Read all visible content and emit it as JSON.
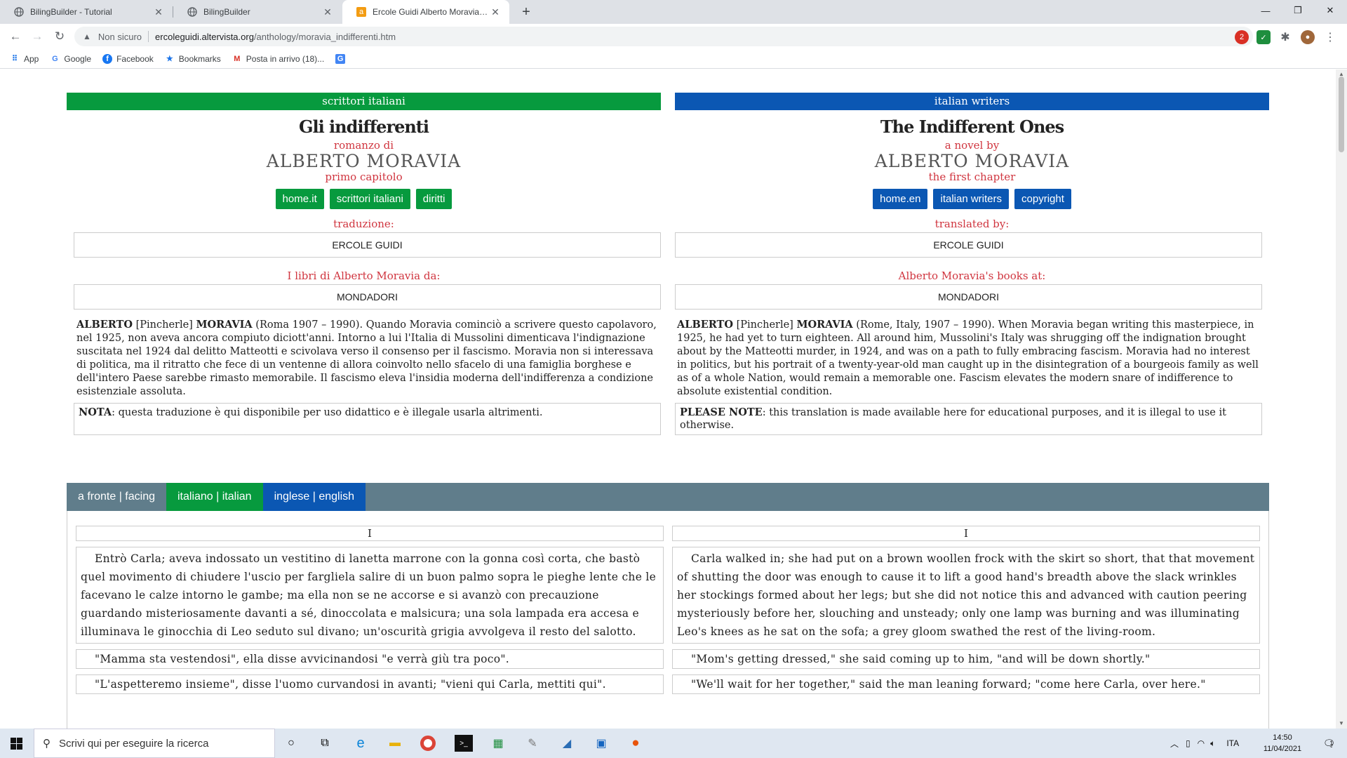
{
  "browser": {
    "tabs": [
      {
        "title": "BilingBuilder - Tutorial",
        "icon": "globe-icon"
      },
      {
        "title": "BilingBuilder",
        "icon": "globe-icon"
      },
      {
        "title": "Ercole Guidi Alberto Moravia - Gl",
        "icon": "altervista-icon",
        "active": true
      }
    ],
    "security_label": "Non sicuro",
    "url_host": "ercoleguidi.altervista.org",
    "url_path": "/anthology/moravia_indifferenti.htm",
    "ext_badge": "2",
    "bookmarks": [
      {
        "label": "App",
        "icon": "apps-grid-icon"
      },
      {
        "label": "Google",
        "icon": "google-icon"
      },
      {
        "label": "Facebook",
        "icon": "facebook-icon"
      },
      {
        "label": "Bookmarks",
        "icon": "star-icon"
      },
      {
        "label": "Posta in arrivo (18)...",
        "icon": "gmail-icon"
      },
      {
        "label": "",
        "icon": "translate-icon"
      }
    ]
  },
  "page": {
    "left": {
      "category": "scrittori italiani",
      "title": "Gli indifferenti",
      "subtitle": "romanzo di",
      "author": "ALBERTO MORAVIA",
      "chapter_note": "primo capitolo",
      "buttons": [
        "home.it",
        "scrittori italiani",
        "diritti"
      ],
      "translation_label": "traduzione:",
      "translator": "ERCOLE GUIDI",
      "books_label": "I libri di Alberto Moravia da:",
      "publisher": "MONDADORI",
      "bio_name1": "ALBERTO",
      "bio_mid": " [Pincherle] ",
      "bio_name2": "MORAVIA",
      "bio_text": " (Roma 1907 – 1990). Quando Moravia cominciò a scrivere questo capolavoro, nel 1925, non aveva ancora compiuto diciott'anni. Intorno a lui l'Italia di Mussolini dimenticava l'indignazione suscitata nel 1924 dal delitto Matteotti e scivolava verso il consenso per il fascismo. Moravia non si interessava di politica, ma il ritratto che fece di un ventenne di allora coinvolto nello sfacelo di una famiglia borghese e dell'intero Paese sarebbe rimasto memorabile. Il fascismo eleva l'insidia moderna dell'indifferenza a condizione esistenziale assoluta.",
      "note_label": "NOTA",
      "note_text": ": questa traduzione è qui disponibile per uso didattico e è illegale usarla altrimenti."
    },
    "right": {
      "category": "italian writers",
      "title": "The Indifferent Ones",
      "subtitle": "a novel by",
      "author": "ALBERTO MORAVIA",
      "chapter_note": "the first chapter",
      "buttons": [
        "home.en",
        "italian writers",
        "copyright"
      ],
      "translation_label": "translated by:",
      "translator": "ERCOLE GUIDI",
      "books_label": "Alberto Moravia's books at:",
      "publisher": "MONDADORI",
      "bio_name1": "ALBERTO",
      "bio_mid": " [Pincherle] ",
      "bio_name2": "MORAVIA",
      "bio_text": " (Rome, Italy, 1907 – 1990). When Moravia began writing this masterpiece, in 1925, he had yet to turn eighteen. All around him, Mussolini's Italy was shrugging off the indignation brought about by the Matteotti murder, in 1924, and was on a path to fully embracing fascism. Moravia had no interest in politics, but his portrait of a twenty-year-old man caught up in the disintegration of a bourgeois family as well as of a whole Nation, would remain a memorable one. Fascism elevates the modern snare of indifference to absolute existential condition.",
      "note_label": "PLEASE NOTE",
      "note_text": ": this translation is made available here for educational purposes, and it is illegal to use it otherwise."
    },
    "view_tabs": [
      "a fronte | facing",
      "italiano | italian",
      "inglese | english"
    ],
    "text": {
      "chapter_left": "I",
      "chapter_right": "I",
      "left_paragraphs": [
        "Entrò Carla; aveva indossato un vestitino di lanetta marrone con la gonna così corta, che bastò quel movimento di chiudere l'uscio per fargliela salire di un buon palmo sopra le pieghe lente che le facevano le calze intorno le gambe; ma ella non se ne accorse e si avanzò con precauzione guardando misteriosamente davanti a sé, dinoccolata e malsicura; una sola lampada era accesa e illuminava le ginocchia di Leo seduto sul divano; un'oscurità grigia avvolgeva il resto del salotto.",
        "\"Mamma sta vestendosi\", ella disse avvicinandosi \"e verrà giù tra poco\".",
        "\"L'aspetteremo insieme\", disse l'uomo curvandosi in avanti; \"vieni qui Carla, mettiti qui\"."
      ],
      "right_paragraphs": [
        "Carla walked in; she had put on a brown woollen frock with the skirt so short, that that movement of shutting the door was enough to cause it to lift a good hand's breadth above the slack wrinkles her stockings formed about her legs; but she did not notice this and advanced with caution peering mysteriously before her, slouching and unsteady; only one lamp was burning and was illuminating Leo's knees as he sat on the sofa; a grey gloom swathed the rest of the living-room.",
        "\"Mom's getting dressed,\" she said coming up to him, \"and will be down shortly.\"",
        "\"We'll wait for her together,\" said the man leaning forward; \"come here Carla, over here.\""
      ]
    }
  },
  "taskbar": {
    "search_placeholder": "Scrivi qui per eseguire la ricerca",
    "language": "ITA",
    "time": "14:50",
    "date": "11/04/2021",
    "notification_count": "1"
  },
  "colors": {
    "green": "#079a3e",
    "blue": "#0b57b3",
    "red_text": "#d0353f",
    "tabs_bar": "#607d8b"
  }
}
